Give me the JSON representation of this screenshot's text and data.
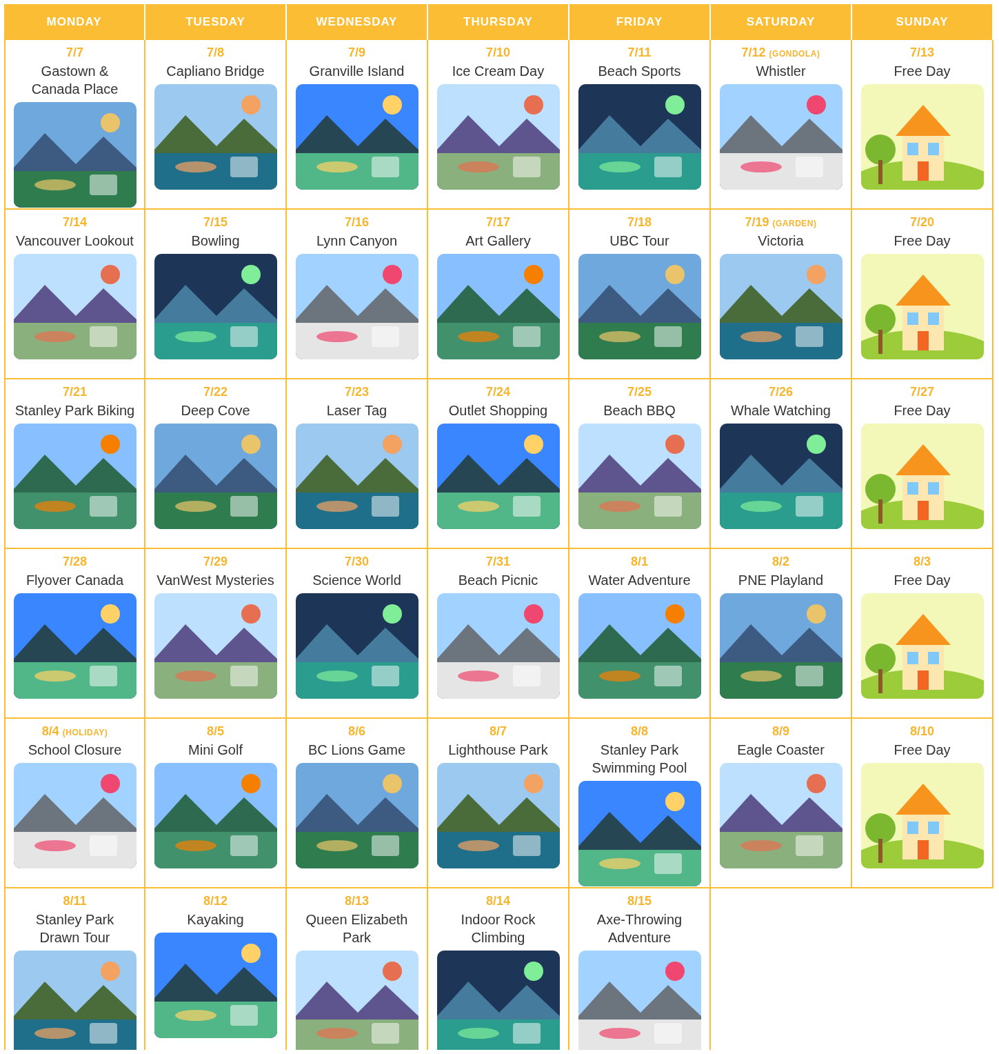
{
  "days": [
    "MONDAY",
    "TUESDAY",
    "WEDNESDAY",
    "THURSDAY",
    "FRIDAY",
    "SATURDAY",
    "SUNDAY"
  ],
  "weeks": [
    [
      {
        "date": "7/7",
        "title": "Gastown &\nCanada Place"
      },
      {
        "date": "7/8",
        "title": "Capliano Bridge"
      },
      {
        "date": "7/9",
        "title": "Granville Island"
      },
      {
        "date": "7/10",
        "title": "Ice Cream Day"
      },
      {
        "date": "7/11",
        "title": "Beach Sports"
      },
      {
        "date": "7/12",
        "note": "(GONDOLA)",
        "title": "Whistler"
      },
      {
        "date": "7/13",
        "title": "Free Day"
      }
    ],
    [
      {
        "date": "7/14",
        "title": "Vancouver Lookout"
      },
      {
        "date": "7/15",
        "title": "Bowling"
      },
      {
        "date": "7/16",
        "title": "Lynn Canyon"
      },
      {
        "date": "7/17",
        "title": "Art Gallery"
      },
      {
        "date": "7/18",
        "title": "UBC Tour"
      },
      {
        "date": "7/19",
        "note": "(GARDEN)",
        "title": "Victoria"
      },
      {
        "date": "7/20",
        "title": "Free Day"
      }
    ],
    [
      {
        "date": "7/21",
        "title": "Stanley Park Biking"
      },
      {
        "date": "7/22",
        "title": "Deep Cove"
      },
      {
        "date": "7/23",
        "title": "Laser Tag"
      },
      {
        "date": "7/24",
        "title": "Outlet Shopping"
      },
      {
        "date": "7/25",
        "title": "Beach BBQ"
      },
      {
        "date": "7/26",
        "title": "Whale Watching"
      },
      {
        "date": "7/27",
        "title": "Free Day"
      }
    ],
    [
      {
        "date": "7/28",
        "title": "Flyover Canada"
      },
      {
        "date": "7/29",
        "title": "VanWest Mysteries"
      },
      {
        "date": "7/30",
        "title": "Science World"
      },
      {
        "date": "7/31",
        "title": "Beach Picnic"
      },
      {
        "date": "8/1",
        "title": "Water Adventure"
      },
      {
        "date": "8/2",
        "title": "PNE Playland"
      },
      {
        "date": "8/3",
        "title": "Free Day"
      }
    ],
    [
      {
        "date": "8/4",
        "note": "(HOLIDAY)",
        "title": "School Closure"
      },
      {
        "date": "8/5",
        "title": "Mini Golf"
      },
      {
        "date": "8/6",
        "title": "BC Lions Game"
      },
      {
        "date": "8/7",
        "title": "Lighthouse Park"
      },
      {
        "date": "8/8",
        "title": "Stanley Park\nSwimming Pool"
      },
      {
        "date": "8/9",
        "title": "Eagle Coaster"
      },
      {
        "date": "8/10",
        "title": "Free Day"
      }
    ],
    [
      {
        "date": "8/11",
        "title": "Stanley Park\nDrawn Tour"
      },
      {
        "date": "8/12",
        "title": "Kayaking"
      },
      {
        "date": "8/13",
        "title": "Queen Elizabeth\nPark"
      },
      {
        "date": "8/14",
        "title": "Indoor Rock\nClimbing"
      },
      {
        "date": "8/15",
        "title": "Axe-Throwing\nAdventure"
      }
    ]
  ]
}
